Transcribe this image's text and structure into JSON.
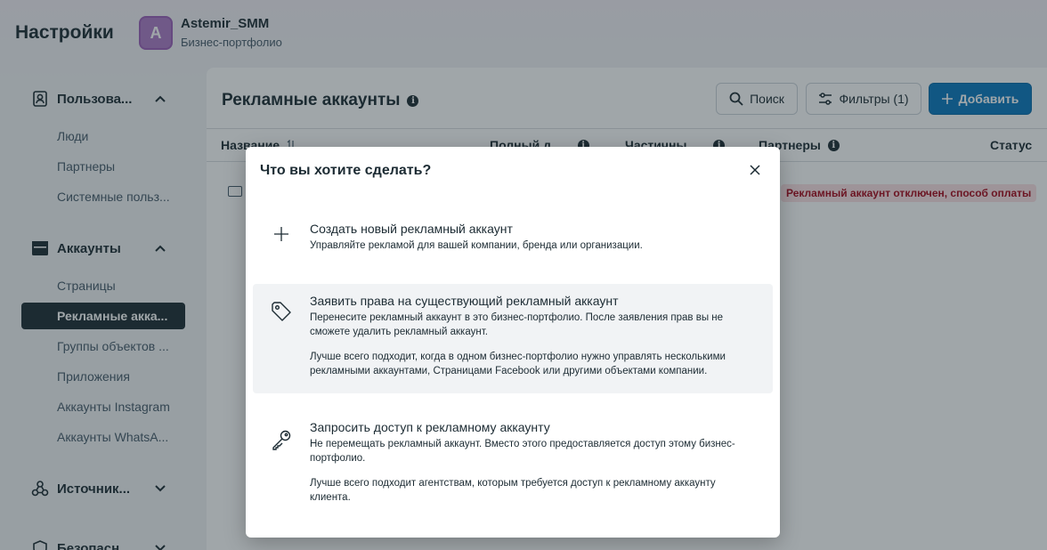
{
  "header": {
    "title": "Настройки",
    "business_initial": "A",
    "business_name": "Astemir_SMM",
    "business_subtitle": "Бизнес-портфолио"
  },
  "sidebar": {
    "sections": [
      {
        "label": "Пользова...",
        "icon": "users-icon",
        "expanded": true
      },
      {
        "label": "Аккаунты",
        "icon": "briefcase-icon",
        "expanded": true
      },
      {
        "label": "Источник...",
        "icon": "data-sources-icon",
        "expanded": false
      },
      {
        "label": "Безопасн...",
        "icon": "shield-icon",
        "expanded": false
      }
    ],
    "users_items": [
      "Люди",
      "Партнеры",
      "Системные польз..."
    ],
    "accounts_items": [
      "Страницы",
      "Рекламные акка...",
      "Группы объектов ...",
      "Приложения",
      "Аккаунты Instagram",
      "Аккаунты WhatsA..."
    ],
    "active_item": "Рекламные акка..."
  },
  "main": {
    "title": "Рекламные аккаунты",
    "search_label": "Поиск",
    "filters_label": "Фильтры (1)",
    "add_label": "Добавить",
    "columns": [
      "Название",
      "Полный д...",
      "Частичны...",
      "Партнеры",
      "Статус"
    ],
    "status_text": "Рекламный аккаунт отключен, способ оплаты"
  },
  "modal": {
    "title": "Что вы хотите сделать?",
    "options": [
      {
        "icon": "plus-icon",
        "title": "Создать новый рекламный аккаунт",
        "description": "Управляйте рекламой для вашей компании, бренда или организации.",
        "note": ""
      },
      {
        "icon": "tag-icon",
        "title": "Заявить права на существующий рекламный аккаунт",
        "description": "Перенесите рекламный аккаунт в это бизнес-портфолио. После заявления прав вы не сможете удалить рекламный аккаунт.",
        "note": "Лучше всего подходит, когда в одном бизнес-портфолио нужно управлять несколькими рекламными аккаунтами, Страницами Facebook или другими объектами компании."
      },
      {
        "icon": "key-icon",
        "title": "Запросить доступ к рекламному аккаунту",
        "description": "Не перемещать рекламный аккаунт. Вместо этого предоставляется доступ этому бизнес-портфолио.",
        "note": "Лучше всего подходит агентствам, которым требуется доступ к рекламному аккаунту клиента."
      }
    ]
  },
  "colors": {
    "primary": "#0a78be",
    "active_nav": "#1c2b33",
    "status_bg": "#fbe1e4",
    "status_text": "#a6081a"
  }
}
